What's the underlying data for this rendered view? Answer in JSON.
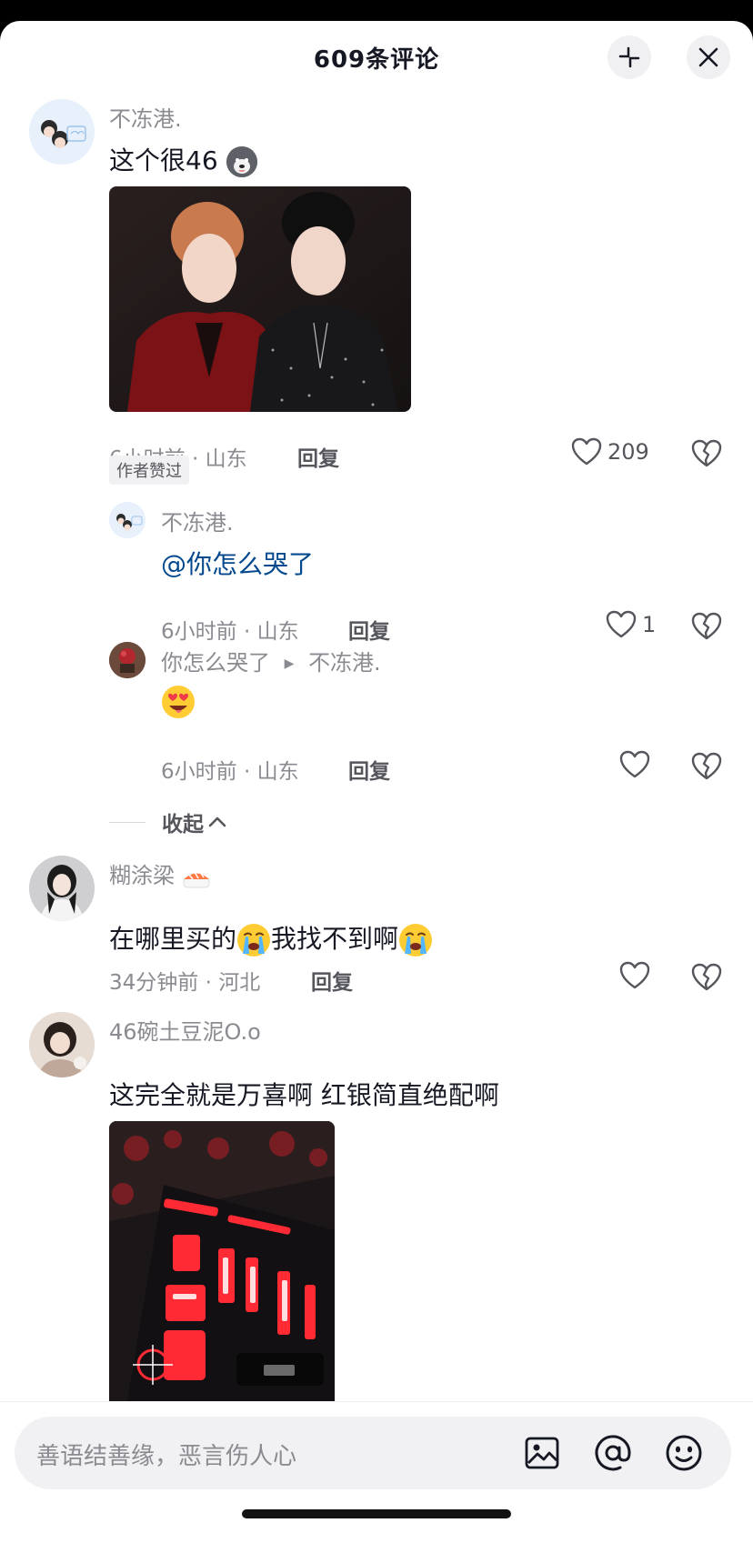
{
  "header": {
    "title": "609条评论",
    "collapse_icon": "minimize-icon",
    "close_icon": "close-icon"
  },
  "comments": [
    {
      "user": "不冻港.",
      "text": "这个很46",
      "emoji": "husky-emoji",
      "meta": "6小时前 · 山东",
      "reply": "回复",
      "likes": "209",
      "badge": "作者赞过",
      "replies": [
        {
          "user": "不冻港.",
          "text": "@你怎么哭了",
          "meta": "6小时前 · 山东",
          "reply": "回复",
          "likes": "1"
        },
        {
          "user": "你怎么哭了",
          "reply_to": "不冻港.",
          "emoji": "heart-eyes-emoji",
          "meta": "6小时前 · 山东",
          "reply": "回复",
          "likes": ""
        }
      ]
    },
    {
      "user": "糊涂梁",
      "user_emoji": "sushi-emoji",
      "text_parts": [
        "在哪里买的",
        "我找不到啊"
      ],
      "emoji": "crying-emoji",
      "meta": "34分钟前 · 河北",
      "reply": "回复",
      "likes": ""
    },
    {
      "user": "46碗土豆泥O.o",
      "text": "这完全就是万喜啊 红银简直绝配啊"
    }
  ],
  "collapse_label": "收起",
  "input": {
    "placeholder": "善语结善缘，恶言伤人心",
    "icons": [
      "image-icon",
      "at-icon",
      "emoji-icon"
    ]
  },
  "colors": {
    "mention": "#04498d",
    "meta": "#8a8b91",
    "text": "#161823"
  }
}
